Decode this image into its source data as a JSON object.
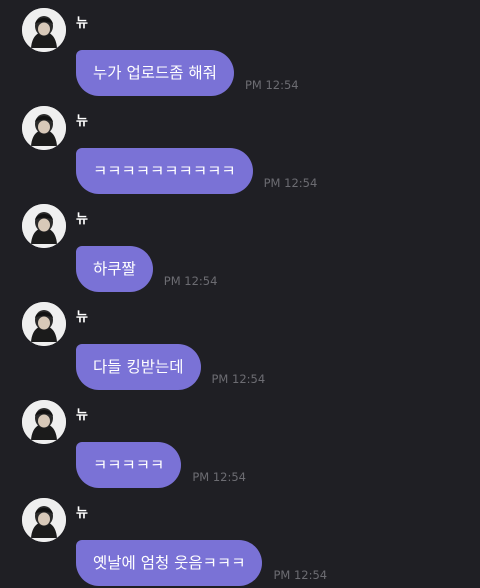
{
  "theme": {
    "background": "#1f1f24",
    "bubble_color": "#7a72d6",
    "time_color": "#6c6c72"
  },
  "messages": [
    {
      "sender": "뉴",
      "avatar_icon": "profile-photo-icon",
      "text": "누가 업로드좀 해줘",
      "time": "PM 12:54"
    },
    {
      "sender": "뉴",
      "avatar_icon": "profile-photo-icon",
      "text": "ㅋㅋㅋㅋㅋㅋㅋㅋㅋㅋ",
      "time": "PM 12:54"
    },
    {
      "sender": "뉴",
      "avatar_icon": "profile-photo-icon",
      "text": "하쿠짤",
      "time": "PM 12:54"
    },
    {
      "sender": "뉴",
      "avatar_icon": "profile-photo-icon",
      "text": "다들 킹받는데",
      "time": "PM 12:54"
    },
    {
      "sender": "뉴",
      "avatar_icon": "profile-photo-icon",
      "text": "ㅋㅋㅋㅋㅋ",
      "time": "PM 12:54"
    },
    {
      "sender": "뉴",
      "avatar_icon": "profile-photo-icon",
      "text": "옛날에 엄청 웃음ㅋㅋㅋ",
      "time": "PM 12:54"
    }
  ]
}
